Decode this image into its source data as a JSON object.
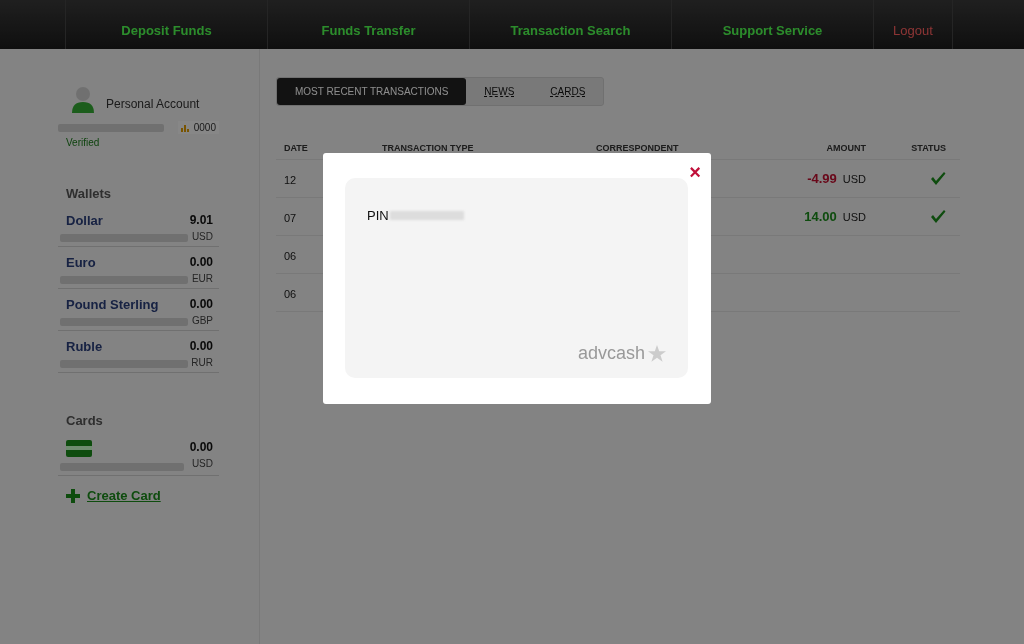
{
  "nav": [
    {
      "label": "Deposit Funds",
      "kind": "normal"
    },
    {
      "label": "Funds Transfer",
      "kind": "normal"
    },
    {
      "label": "Transaction Search",
      "kind": "normal"
    },
    {
      "label": "Support Service",
      "kind": "normal"
    },
    {
      "label": "Logout",
      "kind": "logout"
    }
  ],
  "account": {
    "title": "Personal Account",
    "badge": "0000",
    "status": "Verified"
  },
  "wallets": {
    "heading": "Wallets",
    "items": [
      {
        "name": "Dollar",
        "amount": "9.01",
        "currency": "USD"
      },
      {
        "name": "Euro",
        "amount": "0.00",
        "currency": "EUR"
      },
      {
        "name": "Pound Sterling",
        "amount": "0.00",
        "currency": "GBP"
      },
      {
        "name": "Ruble",
        "amount": "0.00",
        "currency": "RUR"
      }
    ]
  },
  "cards": {
    "heading": "Cards",
    "items": [
      {
        "amount": "0.00",
        "currency": "USD"
      }
    ],
    "create_label": "Create Card"
  },
  "tabs": [
    {
      "label": "MOST RECENT TRANSACTIONS",
      "selected": true
    },
    {
      "label": "NEWS",
      "selected": false
    },
    {
      "label": "CARDS",
      "selected": false
    }
  ],
  "table": {
    "columns": [
      "DATE",
      "TRANSACTION TYPE",
      "CORRESPONDENT",
      "AMOUNT",
      "STATUS"
    ],
    "rows": [
      {
        "date": "12",
        "amount": "-4.99",
        "currency": "USD",
        "kind": "debit",
        "completed": true
      },
      {
        "date": "07",
        "amount": "14.00",
        "currency": "USD",
        "kind": "credit",
        "completed": true
      },
      {
        "date": "06"
      },
      {
        "date": "06"
      }
    ]
  },
  "modal": {
    "close": "×",
    "pin_label": "PIN",
    "brand": "advcash"
  }
}
